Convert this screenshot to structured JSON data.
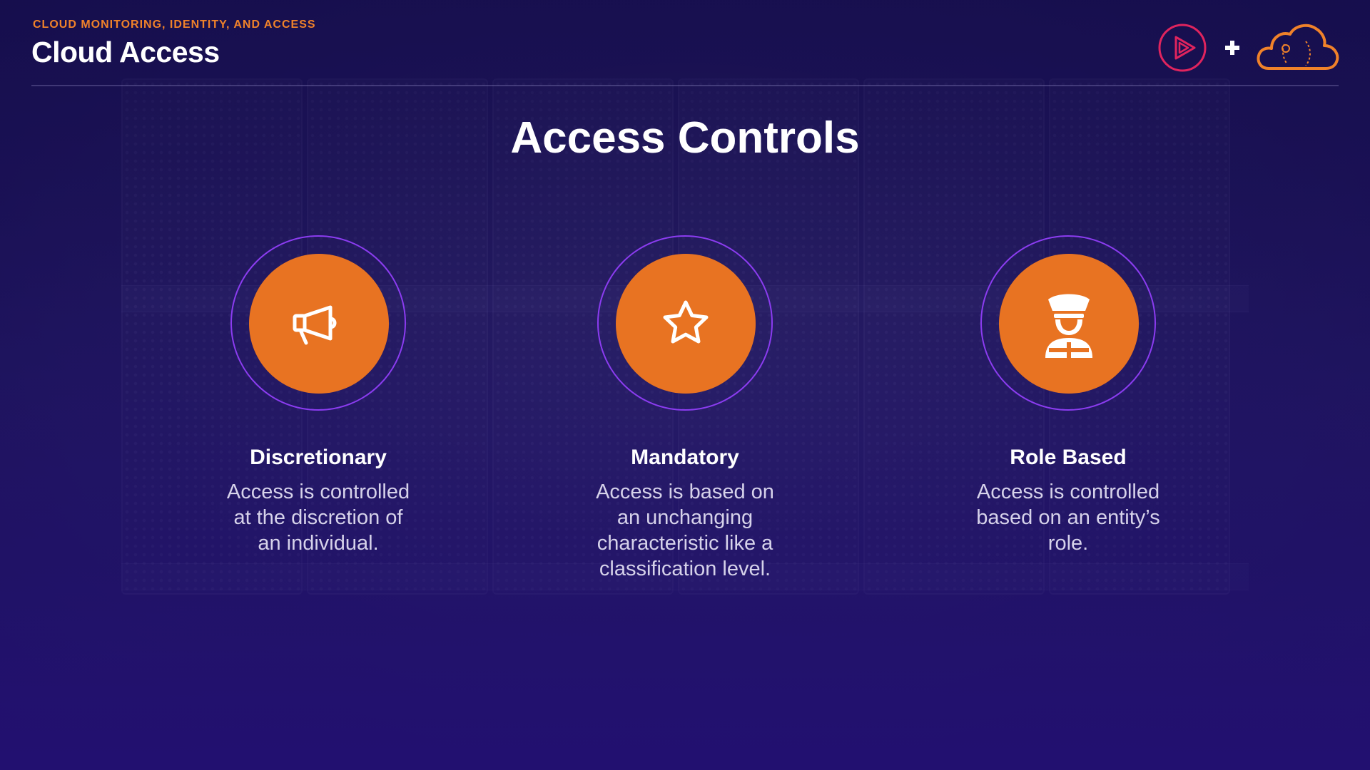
{
  "header": {
    "kicker": "CLOUD MONITORING, IDENTITY, AND ACCESS",
    "course_title": "Cloud Access",
    "logos": {
      "play_logo_icon": "play-triangle-circle-icon",
      "plus_sign": "+",
      "cloud_logo_icon": "cloud-icon"
    }
  },
  "slide": {
    "title": "Access Controls"
  },
  "cards": [
    {
      "icon": "megaphone-icon",
      "title": "Discretionary",
      "description": "Access is controlled at the discretion of an individual."
    },
    {
      "icon": "star-icon",
      "title": "Mandatory",
      "description": "Access is based on an unchanging characteristic like a classification level."
    },
    {
      "icon": "officer-icon",
      "title": "Role Based",
      "description": "Access is controlled based on an entity’s role."
    }
  ],
  "colors": {
    "accent_orange": "#e87322",
    "ring_purple": "#8b3cf0",
    "background_navy": "#1a1250",
    "logo_red": "#e0245e"
  }
}
